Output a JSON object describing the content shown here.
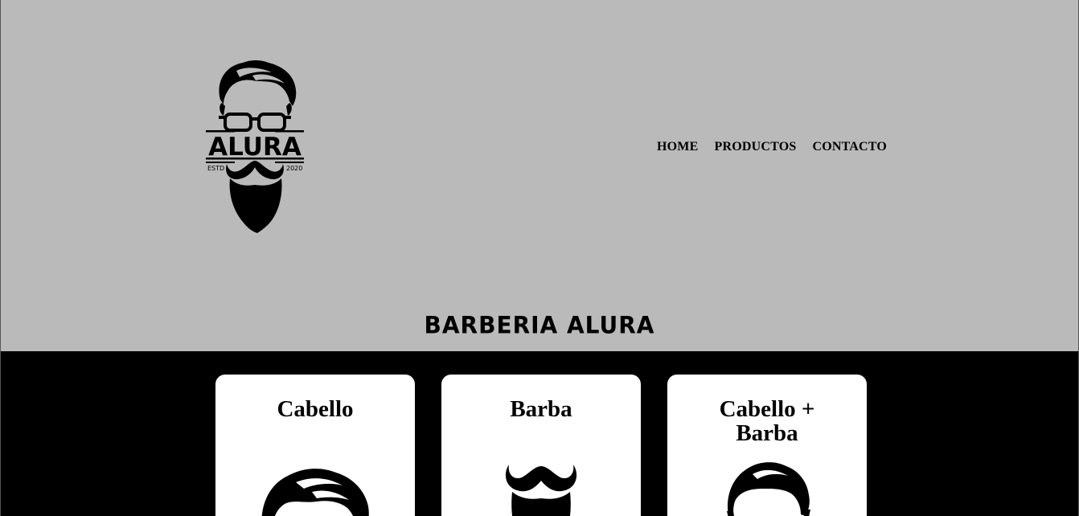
{
  "nav": {
    "items": [
      {
        "label": "HOME"
      },
      {
        "label": "PRODUCTOS"
      },
      {
        "label": "CONTACTO"
      }
    ]
  },
  "logo": {
    "wordmark": "ALURA",
    "left_tag": "ESTD",
    "right_tag": "2020",
    "icon": "bearded-man-glasses-logo"
  },
  "hero": {
    "title": "BARBERIA ALURA"
  },
  "cards": [
    {
      "title": "Cabello",
      "icon": "hair-icon"
    },
    {
      "title": "Barba",
      "icon": "mustache-beard-icon"
    },
    {
      "title": "Cabello + Barba",
      "icon": "hair-beard-icon"
    }
  ],
  "colors": {
    "header_bg": "#bababa",
    "page_bg": "#000000",
    "card_bg": "#ffffff",
    "text": "#000000"
  }
}
